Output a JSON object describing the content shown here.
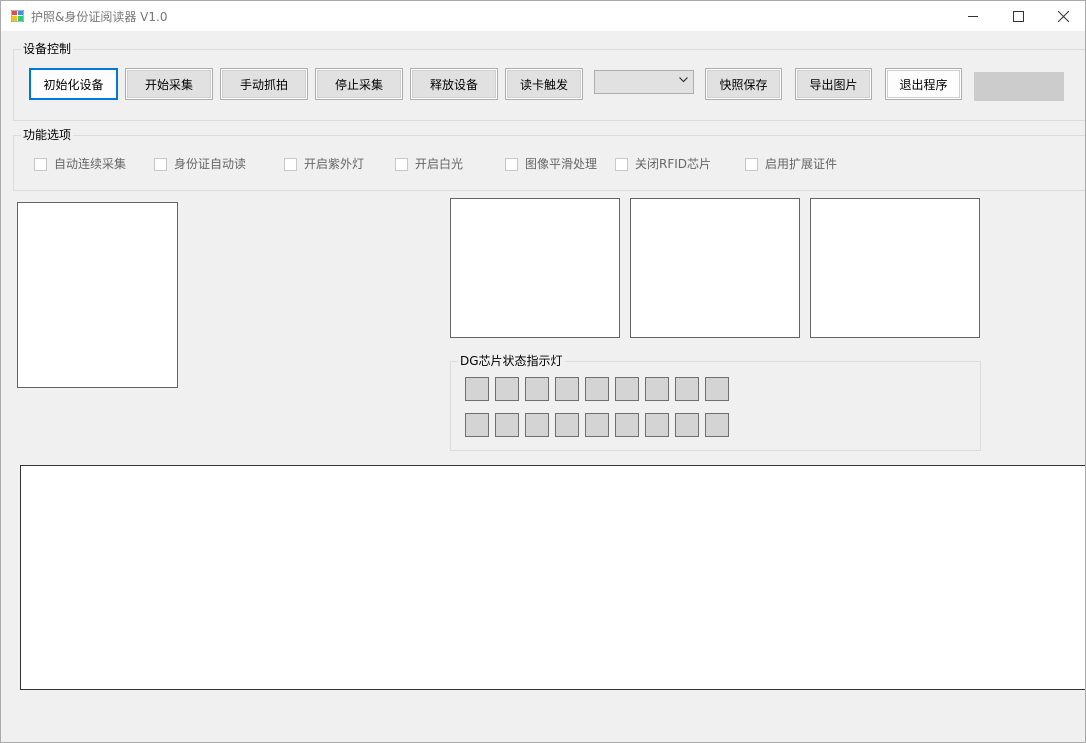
{
  "window": {
    "title": "护照&身份证阅读器 V1.0"
  },
  "device_control": {
    "title": "设备控制",
    "buttons": {
      "init": "初始化设备",
      "start": "开始采集",
      "capture": "手动抓拍",
      "stop": "停止采集",
      "release": "释放设备",
      "trigger": "读卡触发",
      "snapshot_save": "快照保存",
      "export_image": "导出图片",
      "exit": "退出程序"
    },
    "dropdown_value": ""
  },
  "options": {
    "title": "功能选项",
    "items": [
      {
        "label": "自动连续采集",
        "checked": false
      },
      {
        "label": "身份证自动读",
        "checked": false
      },
      {
        "label": "开启紫外灯",
        "checked": false
      },
      {
        "label": "开启白光",
        "checked": false
      },
      {
        "label": "图像平滑处理",
        "checked": false
      },
      {
        "label": "关闭RFID芯片",
        "checked": false
      },
      {
        "label": "启用扩展证件",
        "checked": false
      }
    ]
  },
  "dg_status": {
    "title": "DG芯片状态指示灯",
    "led_color": "#d4d4d4",
    "rows": 2,
    "per_row": 9
  },
  "colors": {
    "accent": "#0078d7",
    "button_bg": "#e1e1e1",
    "window_bg": "#f0f0f0"
  }
}
